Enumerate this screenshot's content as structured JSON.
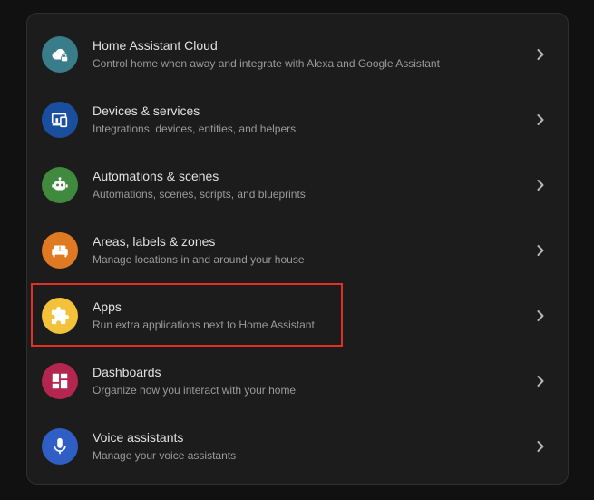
{
  "items": [
    {
      "title": "Home Assistant Cloud",
      "description": "Control home when away and integrate with Alexa and Google Assistant",
      "icon": "cloud-lock-icon",
      "color": "#3a7d8a"
    },
    {
      "title": "Devices & services",
      "description": "Integrations, devices, entities, and helpers",
      "icon": "devices-icon",
      "color": "#1a4fa0"
    },
    {
      "title": "Automations & scenes",
      "description": "Automations, scenes, scripts, and blueprints",
      "icon": "robot-icon",
      "color": "#3f8a3c"
    },
    {
      "title": "Areas, labels & zones",
      "description": "Manage locations in and around your house",
      "icon": "sofa-icon",
      "color": "#e07a22"
    },
    {
      "title": "Apps",
      "description": "Run extra applications next to Home Assistant",
      "icon": "puzzle-icon",
      "color": "#f3c13a"
    },
    {
      "title": "Dashboards",
      "description": "Organize how you interact with your home",
      "icon": "dashboard-icon",
      "color": "#b32650"
    },
    {
      "title": "Voice assistants",
      "description": "Manage your voice assistants",
      "icon": "microphone-icon",
      "color": "#2f5fc4"
    }
  ],
  "highlight_color": "#e03224"
}
